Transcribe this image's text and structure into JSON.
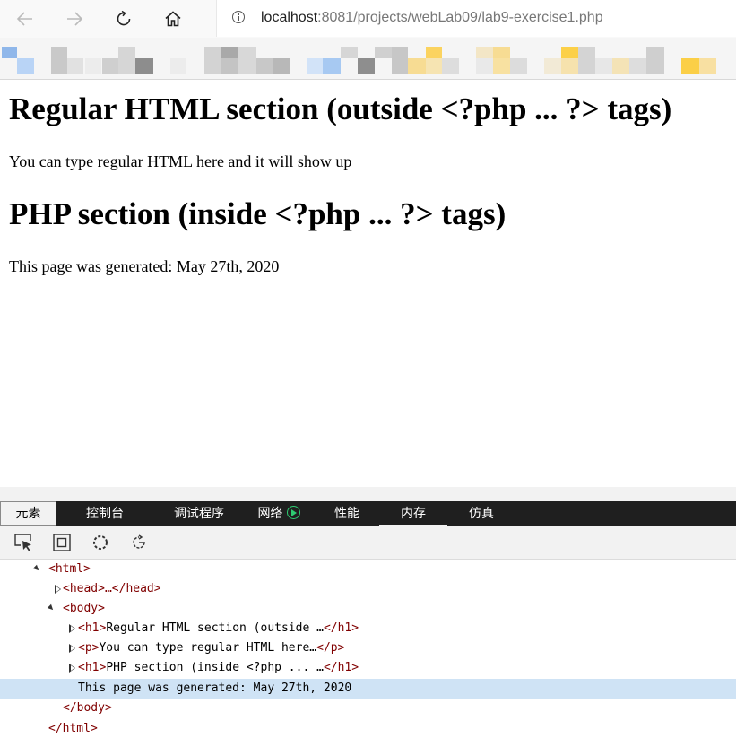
{
  "browser": {
    "url_host": "localhost",
    "url_rest": ":8081/projects/webLab09/lab9-exercise1.php"
  },
  "page": {
    "heading1": "Regular HTML section (outside <?php ... ?> tags)",
    "para1": "You can type regular HTML here and it will show up",
    "heading2": "PHP section (inside <?php ... ?> tags)",
    "para2": "This page was generated: May 27th, 2020"
  },
  "devtools": {
    "tabs": [
      {
        "label": "元素"
      },
      {
        "label": "控制台"
      },
      {
        "label": "调试程序"
      },
      {
        "label": "网络"
      },
      {
        "label": "性能"
      },
      {
        "label": "内存"
      },
      {
        "label": "仿真"
      }
    ],
    "tree": {
      "html_open": "<html>",
      "head": "<head>…</head>",
      "body_open": "<body>",
      "h1_open": "<h1>",
      "h1_text_1": "Regular HTML section (outside …",
      "h1_close": "</h1>",
      "p_open": "<p>",
      "p_text": "You can type regular HTML here…",
      "p_close": "</p>",
      "h1_text_2": "PHP section (inside <?php ... …",
      "text_node": "This page was generated: May 27th, 2020",
      "body_close": "</body>",
      "html_close": "</html>"
    }
  },
  "colors": {
    "tag": "#800000",
    "selection": "#cfe3f5",
    "network_indicator": "#2ecc71"
  }
}
